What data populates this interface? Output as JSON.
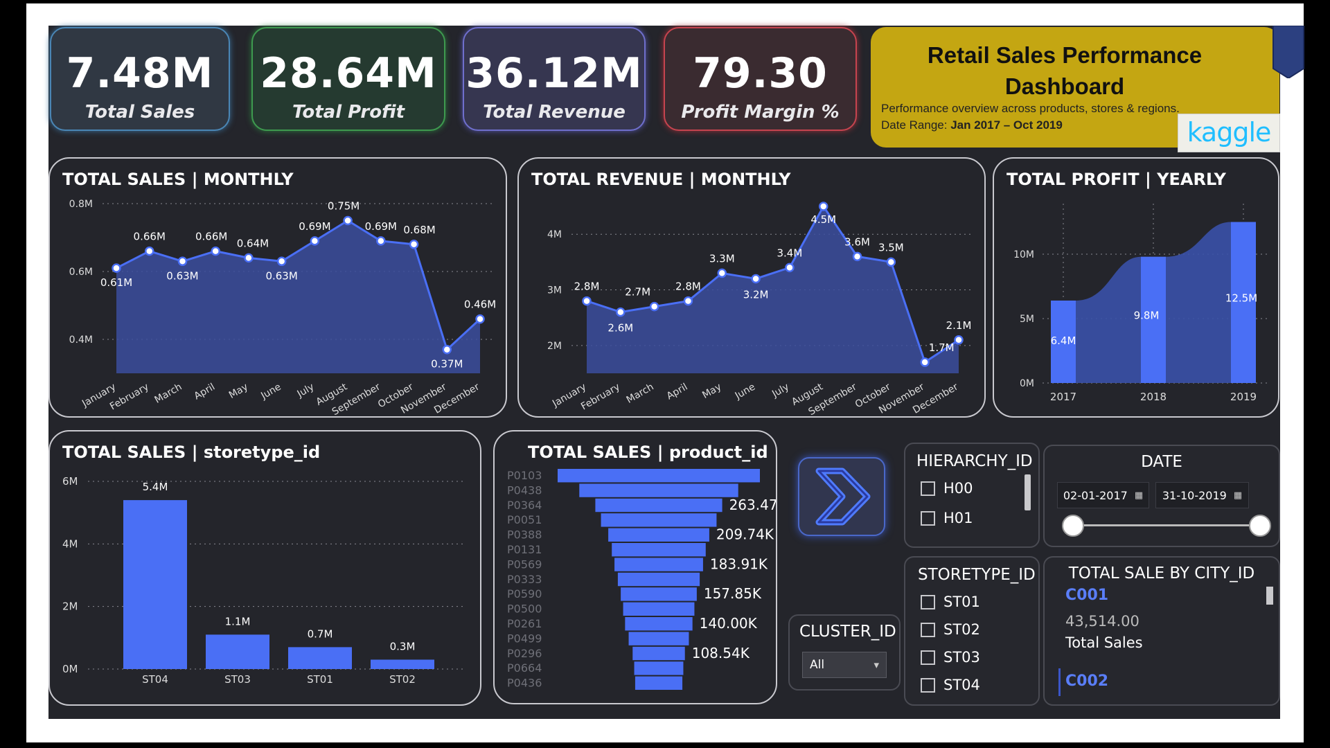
{
  "kpis": [
    {
      "value": "7.48M",
      "label": "Total Sales"
    },
    {
      "value": "28.64M",
      "label": "Total Profit"
    },
    {
      "value": "36.12M",
      "label": "Total Revenue"
    },
    {
      "value": "79.30",
      "label": "Profit Margin %"
    }
  ],
  "header": {
    "title": "Retail Sales Performance Dashboard",
    "subtitle": "Performance overview across products, stores & regions.",
    "range_prefix": "Date Range: ",
    "range_value": "Jan 2017 – Oct 2019",
    "logo_text": "kaggle"
  },
  "colors": {
    "accent": "#4a6ff5",
    "area": "#3b4e9e",
    "title_card": "#c4a612",
    "kaggle": "#20beff"
  },
  "icons": {
    "bookmark": "bookmark-icon",
    "next": "chevron-right-icon",
    "calendar": "calendar-icon",
    "dropdown": "chevron-down-icon"
  },
  "chart_data": [
    {
      "type": "area",
      "title": "TOTAL SALES | MONTHLY",
      "categories": [
        "January",
        "February",
        "March",
        "April",
        "May",
        "June",
        "July",
        "August",
        "September",
        "October",
        "November",
        "December"
      ],
      "values": [
        0.61,
        0.66,
        0.63,
        0.66,
        0.64,
        0.63,
        0.69,
        0.75,
        0.69,
        0.68,
        0.37,
        0.46
      ],
      "data_labels": [
        "0.61M",
        "0.66M",
        "0.63M",
        "0.66M",
        "0.64M",
        "0.63M",
        "0.69M",
        "0.75M",
        "0.69M",
        "0.68M",
        "0.37M",
        "0.46M"
      ],
      "yticks": [
        "0.4M",
        "0.6M",
        "0.8M"
      ],
      "ylim": [
        0.3,
        0.8
      ],
      "grid": true
    },
    {
      "type": "area",
      "title": "TOTAL REVENUE | MONTHLY",
      "categories": [
        "January",
        "February",
        "March",
        "April",
        "May",
        "June",
        "July",
        "August",
        "September",
        "October",
        "November",
        "December"
      ],
      "values": [
        2.8,
        2.6,
        2.7,
        2.8,
        3.3,
        3.2,
        3.4,
        4.5,
        3.6,
        3.5,
        1.7,
        2.1
      ],
      "data_labels": [
        "2.8M",
        "2.6M",
        "2.7M",
        "2.8M",
        "3.3M",
        "3.2M",
        "3.4M",
        "4.5M",
        "3.6M",
        "3.5M",
        "1.7M",
        "2.1M"
      ],
      "yticks": [
        "2M",
        "3M",
        "4M"
      ],
      "ylim": [
        1.5,
        4.6
      ],
      "grid": true
    },
    {
      "type": "bar",
      "title": "TOTAL PROFIT | YEARLY",
      "categories": [
        "2017",
        "2018",
        "2019"
      ],
      "values": [
        6.4,
        9.8,
        12.5
      ],
      "data_labels": [
        "6.4M",
        "9.8M",
        "12.5M"
      ],
      "yticks": [
        "0M",
        "5M",
        "10M"
      ],
      "ylim": [
        0,
        15
      ],
      "grid": true
    },
    {
      "type": "bar",
      "title": "TOTAL SALES | storetype_id",
      "categories": [
        "ST04",
        "ST03",
        "ST01",
        "ST02"
      ],
      "values": [
        5.4,
        1.1,
        0.7,
        0.3
      ],
      "data_labels": [
        "5.4M",
        "1.1M",
        "0.7M",
        "0.3M"
      ],
      "yticks": [
        "0M",
        "2M",
        "4M",
        "6M"
      ],
      "ylim": [
        0,
        6
      ],
      "grid": true
    },
    {
      "type": "bar",
      "title": "TOTAL SALES | product_id",
      "orientation": "funnel",
      "categories": [
        "P0103",
        "P0438",
        "P0364",
        "P0051",
        "P0388",
        "P0131",
        "P0569",
        "P0333",
        "P0590",
        "P0500",
        "P0261",
        "P0499",
        "P0296",
        "P0664",
        "P0436"
      ],
      "values": [
        420,
        330,
        263.47,
        240,
        209.74,
        195,
        183.91,
        170,
        157.85,
        148,
        140.0,
        125,
        108.54,
        102,
        98
      ],
      "data_labels": [
        "",
        "",
        "263.47K",
        "",
        "209.74K",
        "",
        "183.91K",
        "",
        "157.85K",
        "",
        "140.00K",
        "",
        "108.54K",
        "",
        ""
      ]
    }
  ],
  "slicers": {
    "hierarchy": {
      "title": "HIERARCHY_ID",
      "items": [
        "H00",
        "H01"
      ]
    },
    "date": {
      "title": "DATE",
      "start": "02-01-2017",
      "end": "31-10-2019"
    },
    "storetype": {
      "title": "STORETYPE_ID",
      "items": [
        "ST01",
        "ST02",
        "ST03",
        "ST04"
      ]
    },
    "cluster": {
      "title": "CLUSTER_ID",
      "selected": "All"
    },
    "city": {
      "title": "TOTAL SALE BY CITY_ID",
      "cities": [
        "C001",
        "C002"
      ],
      "value": "43,514.00",
      "measure": "Total Sales"
    }
  }
}
